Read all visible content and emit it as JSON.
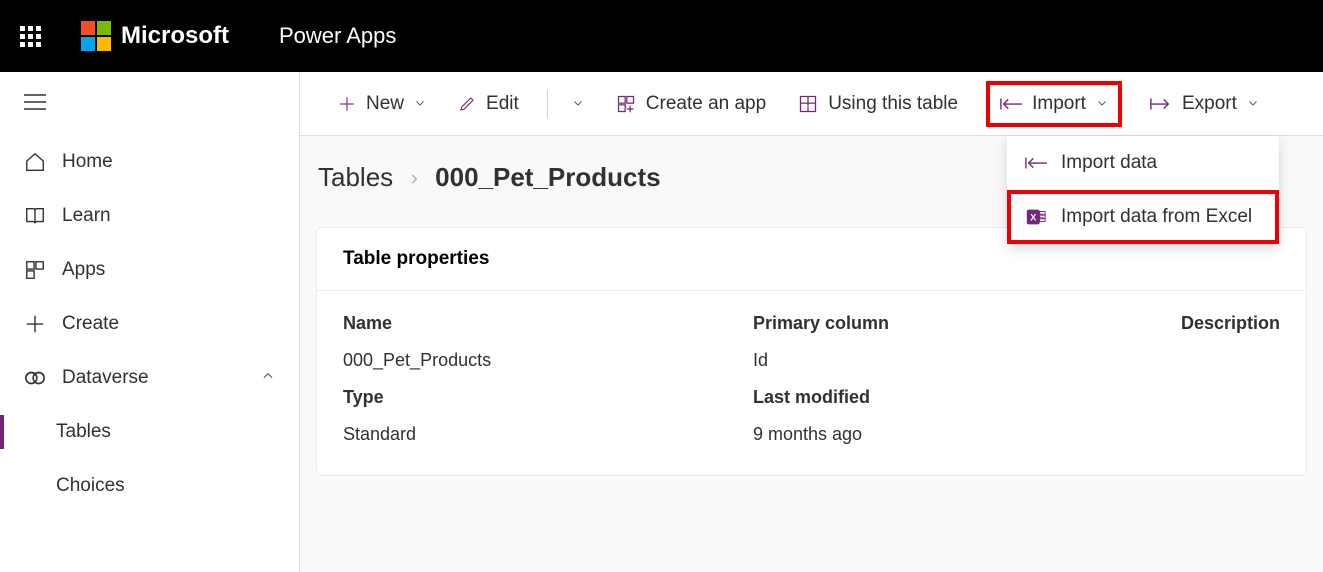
{
  "header": {
    "brand": "Microsoft",
    "app_name": "Power Apps"
  },
  "sidebar": {
    "items": [
      {
        "label": "Home"
      },
      {
        "label": "Learn"
      },
      {
        "label": "Apps"
      },
      {
        "label": "Create"
      },
      {
        "label": "Dataverse"
      },
      {
        "label": "Tables"
      },
      {
        "label": "Choices"
      }
    ]
  },
  "command_bar": {
    "new": "New",
    "edit": "Edit",
    "create_app": "Create an app",
    "using_table": "Using this table",
    "import": "Import",
    "export": "Export"
  },
  "dropdown": {
    "import_data": "Import data",
    "import_excel": "Import data from Excel"
  },
  "breadcrumb": {
    "root": "Tables",
    "current": "000_Pet_Products"
  },
  "card": {
    "title": "Table properties",
    "labels": {
      "name": "Name",
      "primary_column": "Primary column",
      "description": "Description",
      "type": "Type",
      "last_modified": "Last modified"
    },
    "values": {
      "name": "000_Pet_Products",
      "primary_column": "Id",
      "type": "Standard",
      "last_modified": "9 months ago"
    }
  }
}
